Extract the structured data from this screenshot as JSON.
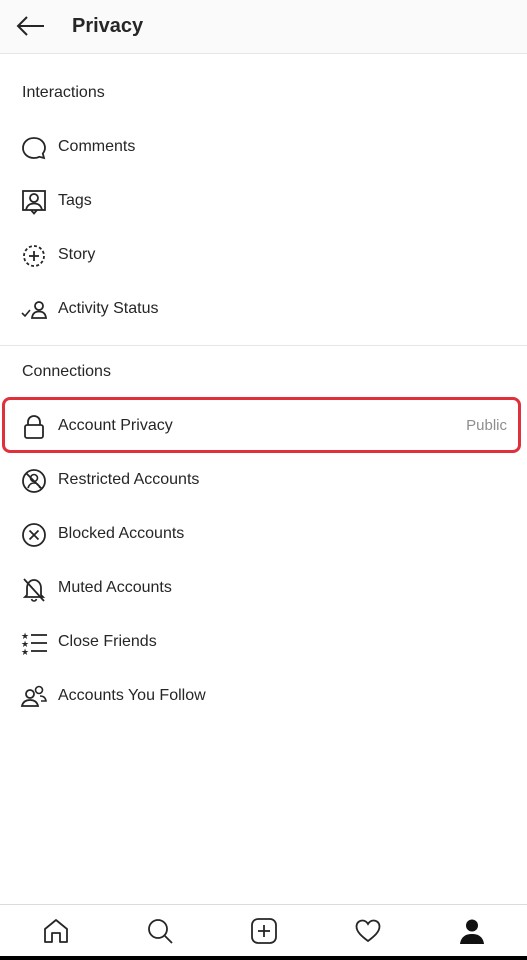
{
  "header": {
    "title": "Privacy",
    "back_icon": "arrow-left-icon"
  },
  "interactions": {
    "title": "Interactions",
    "items": [
      {
        "label": "Comments",
        "icon": "comment-bubble-icon"
      },
      {
        "label": "Tags",
        "icon": "tag-person-icon"
      },
      {
        "label": "Story",
        "icon": "story-plus-icon"
      },
      {
        "label": "Activity Status",
        "icon": "activity-status-icon"
      }
    ]
  },
  "connections": {
    "title": "Connections",
    "items": [
      {
        "label": "Account Privacy",
        "value": "Public",
        "icon": "lock-icon",
        "highlighted": true
      },
      {
        "label": "Restricted Accounts",
        "icon": "restricted-icon"
      },
      {
        "label": "Blocked Accounts",
        "icon": "blocked-x-icon"
      },
      {
        "label": "Muted Accounts",
        "icon": "muted-bell-icon"
      },
      {
        "label": "Close Friends",
        "icon": "close-friends-list-icon"
      },
      {
        "label": "Accounts You Follow",
        "icon": "people-icon"
      }
    ]
  },
  "tabbar": {
    "tabs": [
      {
        "name": "home",
        "icon": "home-icon"
      },
      {
        "name": "search",
        "icon": "search-icon"
      },
      {
        "name": "create",
        "icon": "plus-square-icon"
      },
      {
        "name": "activity",
        "icon": "heart-icon"
      },
      {
        "name": "profile",
        "icon": "profile-icon",
        "active": true
      }
    ]
  },
  "colors": {
    "text": "#262626",
    "muted": "#8e8e8e",
    "highlight_border": "#e0303c",
    "divider": "#e6e6e6"
  }
}
